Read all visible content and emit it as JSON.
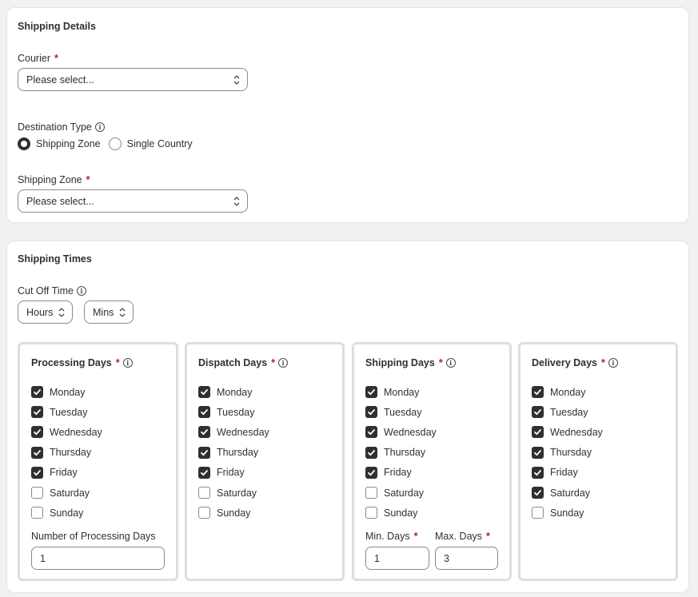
{
  "shipping_details": {
    "title": "Shipping Details",
    "courier": {
      "label": "Courier",
      "required_mark": "*",
      "value": "Please select..."
    },
    "destination_type": {
      "label": "Destination Type",
      "options": [
        {
          "label": "Shipping Zone",
          "selected": true
        },
        {
          "label": "Single Country",
          "selected": false
        }
      ]
    },
    "shipping_zone": {
      "label": "Shipping Zone",
      "required_mark": "*",
      "value": "Please select..."
    }
  },
  "shipping_times": {
    "title": "Shipping Times",
    "cut_off_time": {
      "label": "Cut Off Time",
      "hours": "Hours",
      "mins": "Mins"
    },
    "groups": [
      {
        "title": "Processing Days",
        "required_mark": "*",
        "days": [
          {
            "label": "Monday",
            "checked": true
          },
          {
            "label": "Tuesday",
            "checked": true
          },
          {
            "label": "Wednesday",
            "checked": true
          },
          {
            "label": "Thursday",
            "checked": true
          },
          {
            "label": "Friday",
            "checked": true
          },
          {
            "label": "Saturday",
            "checked": false
          },
          {
            "label": "Sunday",
            "checked": false
          }
        ],
        "number_label": "Number of Processing Days",
        "number_value": "1"
      },
      {
        "title": "Dispatch Days",
        "required_mark": "*",
        "days": [
          {
            "label": "Monday",
            "checked": true
          },
          {
            "label": "Tuesday",
            "checked": true
          },
          {
            "label": "Wednesday",
            "checked": true
          },
          {
            "label": "Thursday",
            "checked": true
          },
          {
            "label": "Friday",
            "checked": true
          },
          {
            "label": "Saturday",
            "checked": false
          },
          {
            "label": "Sunday",
            "checked": false
          }
        ]
      },
      {
        "title": "Shipping Days",
        "required_mark": "*",
        "days": [
          {
            "label": "Monday",
            "checked": true
          },
          {
            "label": "Tuesday",
            "checked": true
          },
          {
            "label": "Wednesday",
            "checked": true
          },
          {
            "label": "Thursday",
            "checked": true
          },
          {
            "label": "Friday",
            "checked": true
          },
          {
            "label": "Saturday",
            "checked": false
          },
          {
            "label": "Sunday",
            "checked": false
          }
        ],
        "min_label": "Min. Days",
        "min_value": "1",
        "max_label": "Max. Days",
        "max_value": "3"
      },
      {
        "title": "Delivery Days",
        "required_mark": "*",
        "days": [
          {
            "label": "Monday",
            "checked": true
          },
          {
            "label": "Tuesday",
            "checked": true
          },
          {
            "label": "Wednesday",
            "checked": true
          },
          {
            "label": "Thursday",
            "checked": true
          },
          {
            "label": "Friday",
            "checked": true
          },
          {
            "label": "Saturday",
            "checked": true
          },
          {
            "label": "Sunday",
            "checked": false
          }
        ]
      }
    ]
  },
  "colors": {
    "accent": "#303030",
    "required": "#b02020",
    "border": "#8a8a8a",
    "background": "#f1f1f1"
  },
  "icons": {
    "info": "info-icon",
    "select": "chevron-up-down-icon",
    "check": "check-icon"
  }
}
